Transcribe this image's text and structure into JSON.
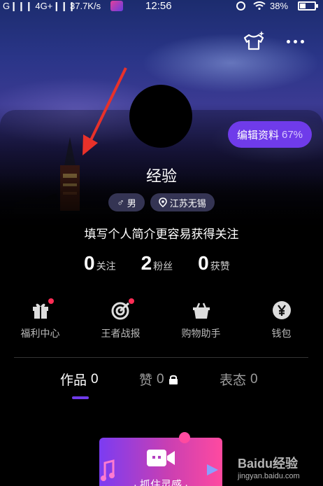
{
  "status_bar": {
    "network": "G❙❙❙ 4G+❙❙❙",
    "speed": "37.7K/s",
    "time": "12:56",
    "battery_percent": "38%",
    "battery_level": 0.38
  },
  "profile": {
    "edit_label": "编辑资料",
    "edit_progress": "67%",
    "nickname": "经验",
    "gender": "男",
    "location": "江苏无锡",
    "bio": "填写个人简介更容易获得关注"
  },
  "stats": [
    {
      "value": "0",
      "label": "关注"
    },
    {
      "value": "2",
      "label": "粉丝"
    },
    {
      "value": "0",
      "label": "获赞"
    }
  ],
  "services": [
    {
      "label": "福利中心",
      "icon": "gift-icon",
      "badge": true
    },
    {
      "label": "王者战报",
      "icon": "target-icon",
      "badge": true
    },
    {
      "label": "购物助手",
      "icon": "basket-icon",
      "badge": false
    },
    {
      "label": "钱包",
      "icon": "yuan-wallet-icon",
      "badge": false
    }
  ],
  "tabs": [
    {
      "label": "作品",
      "count": "0",
      "active": true
    },
    {
      "label": "赞",
      "count": "0",
      "locked": true
    },
    {
      "label": "表态",
      "count": "0"
    }
  ],
  "banner": {
    "text": "· 抓住灵感 ·"
  },
  "watermark": {
    "main": "Baidu经验",
    "sub": "jingyan.baidu.com"
  },
  "colors": {
    "accent": "#6f3bea",
    "badge": "#ff2d55",
    "annotation_arrow": "#e8312a"
  }
}
